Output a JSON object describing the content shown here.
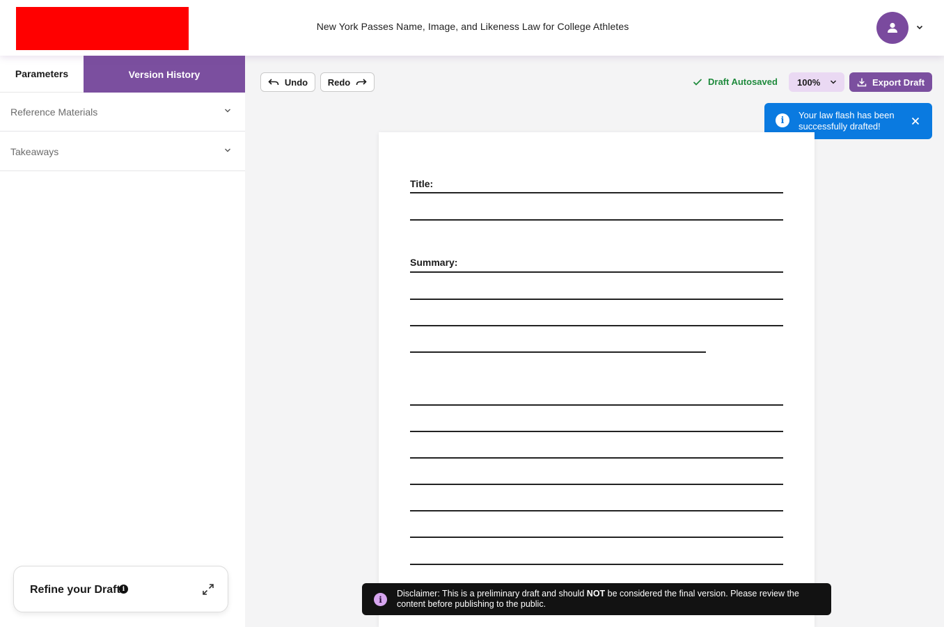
{
  "header": {
    "document_title": "New York Passes Name, Image, and Likeness Law for College Athletes",
    "avatar_icon": "user-icon",
    "menu_icon": "chevron-down-icon"
  },
  "sidebar": {
    "tabs": [
      {
        "label": "Parameters"
      },
      {
        "label": "Version History"
      }
    ],
    "accordion": [
      {
        "label": "Reference Materials"
      },
      {
        "label": "Takeaways"
      }
    ],
    "refine": {
      "label": "Refine your Draft"
    }
  },
  "toolbar": {
    "undo_label": "Undo",
    "redo_label": "Redo",
    "autosave_status": "Draft Autosaved",
    "zoom_level": "100%",
    "export_label": "Export Draft"
  },
  "toast": {
    "message": "Your law flash has been successfully drafted!"
  },
  "document": {
    "title_label": "Title:",
    "summary_label": "Summary:"
  },
  "disclaimer": {
    "prefix": "Disclaimer: This is a preliminary draft and should ",
    "emphasis": "NOT",
    "suffix": " be considered the final version. Please review the content before publishing to the public."
  },
  "colors": {
    "brand_purple": "#7b4f9f",
    "toast_blue": "#0a7ae0",
    "success_green": "#1e8a3c",
    "logo_red": "#ff0000"
  }
}
